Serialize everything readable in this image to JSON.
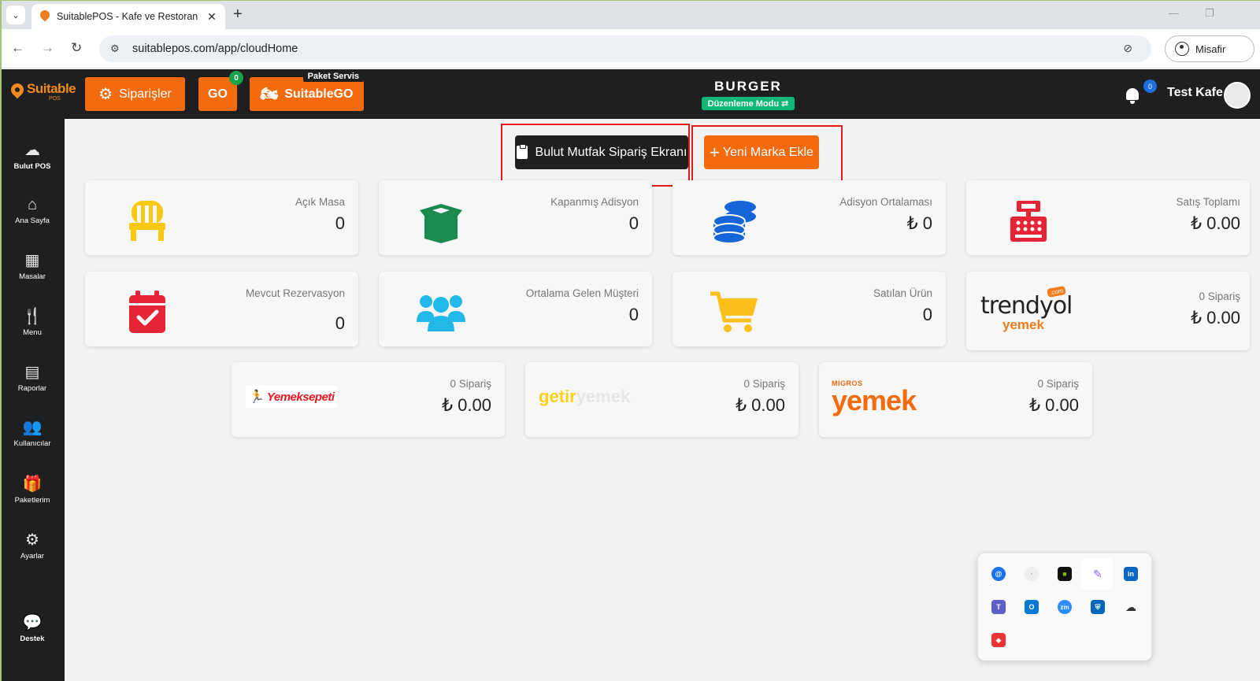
{
  "browser": {
    "tab_title": "SuitablePOS - Kafe ve Restoran",
    "close_glyph": "✕",
    "new_tab_glyph": "+",
    "url": "suitablepos.com/app/cloudHome",
    "profile_label": "Misafir"
  },
  "header": {
    "logo_text": "Suitable",
    "logo_sub": "POS",
    "orders_label": "Siparişler",
    "go_label": "GO",
    "go_badge": "0",
    "suitablego_label": "SuitableGO",
    "paket_servis_label": "Paket Servis",
    "brand_name": "BURGER",
    "edit_mode_label": "Düzenleme Modu ⇄",
    "notif_count": "0",
    "user_name": "Test Kafe"
  },
  "sidebar": {
    "items": [
      {
        "label": "Bulut POS",
        "icon": "cloud-icon"
      },
      {
        "label": "Ana Sayfa",
        "icon": "home-icon"
      },
      {
        "label": "Masalar",
        "icon": "table-icon"
      },
      {
        "label": "Menu",
        "icon": "utensils-icon"
      },
      {
        "label": "Raporlar",
        "icon": "report-icon"
      },
      {
        "label": "Kullanıcılar",
        "icon": "users-icon"
      },
      {
        "label": "Paketlerim",
        "icon": "gift-icon"
      },
      {
        "label": "Ayarlar",
        "icon": "settings-icon"
      },
      {
        "label": "Destek",
        "icon": "chat-icon"
      }
    ]
  },
  "actions": {
    "kitchen_button": "Bulut Mutfak Sipariş Ekranı",
    "new_brand_button": "Yeni Marka Ekle"
  },
  "stats": {
    "open_tables": {
      "label": "Açık Masa",
      "value": "0"
    },
    "closed_checks": {
      "label": "Kapanmış Adisyon",
      "value": "0"
    },
    "avg_check": {
      "label": "Adisyon Ortalaması",
      "value": "₺ 0"
    },
    "total_sales": {
      "label": "Satış Toplamı",
      "value": "₺ 0.00"
    },
    "reservations": {
      "label": "Mevcut Rezervasyon",
      "value": "0"
    },
    "avg_customers": {
      "label": "Ortalama Gelen Müşteri",
      "value": "0"
    },
    "sold_products": {
      "label": "Satılan Ürün",
      "value": "0"
    }
  },
  "integrations": {
    "trendyol": {
      "logo_main": "trendyol",
      "logo_sub": "yemek",
      "logo_com": ".com",
      "orders": "0 Sipariş",
      "amount": "₺ 0.00"
    },
    "yemeksepeti": {
      "logo": "Yemeksepeti",
      "orders": "0 Sipariş",
      "amount": "₺ 0.00"
    },
    "getir": {
      "logo_a": "getir",
      "logo_b": "yemek",
      "orders": "0 Sipariş",
      "amount": "₺ 0.00"
    },
    "migros": {
      "logo_a": "MIGROS",
      "logo_b": "yemek",
      "orders": "0 Sipariş",
      "amount": "₺ 0.00"
    }
  },
  "colors": {
    "accent_orange": "#f36b0d",
    "header_dark": "#1d1f21",
    "highlight_red": "#e01b1b",
    "edit_mode_green": "#0fb877"
  }
}
